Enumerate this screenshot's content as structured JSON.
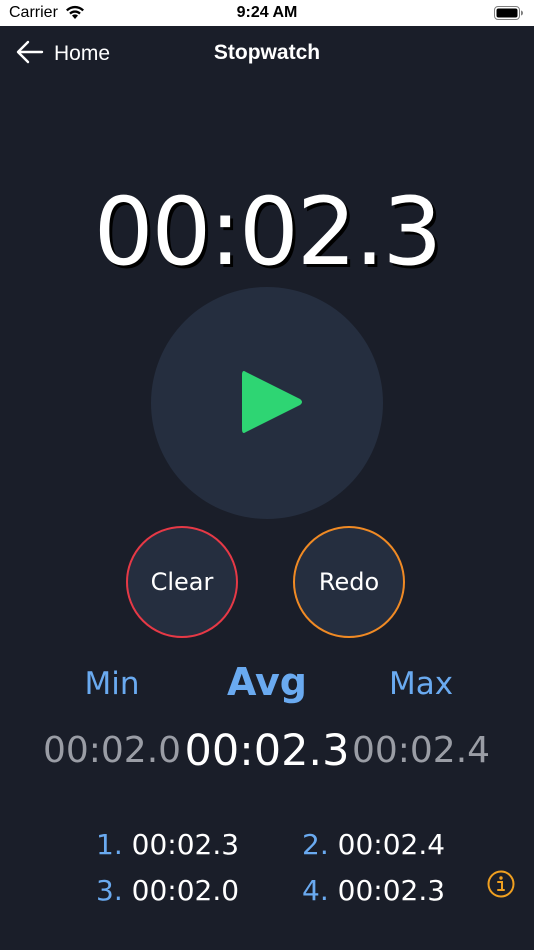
{
  "status_bar": {
    "carrier": "Carrier",
    "time": "9:24 AM"
  },
  "nav": {
    "back_label": "Home",
    "title": "Stopwatch"
  },
  "timer": {
    "display": "00:02.3"
  },
  "controls": {
    "clear_label": "Clear",
    "redo_label": "Redo"
  },
  "stats": {
    "min_label": "Min",
    "avg_label": "Avg",
    "max_label": "Max",
    "min_value": "00:02.0",
    "avg_value": "00:02.3",
    "max_value": "00:02.4"
  },
  "laps": [
    {
      "index": "1.",
      "time": "00:02.3"
    },
    {
      "index": "2.",
      "time": "00:02.4"
    },
    {
      "index": "3.",
      "time": "00:02.0"
    },
    {
      "index": "4.",
      "time": "00:02.3"
    }
  ],
  "icons": {
    "back": "arrow-left-icon",
    "play": "play-icon",
    "info": "info-icon",
    "wifi": "wifi-icon",
    "battery": "battery-icon"
  },
  "colors": {
    "background": "#1a1e29",
    "button_fill": "#252e3f",
    "play_green": "#2ed573",
    "clear_border": "#e63946",
    "redo_border": "#f08a24",
    "stat_blue": "#6aaaf0",
    "stat_gray": "#9a9da5",
    "info_orange": "#f0a020"
  }
}
